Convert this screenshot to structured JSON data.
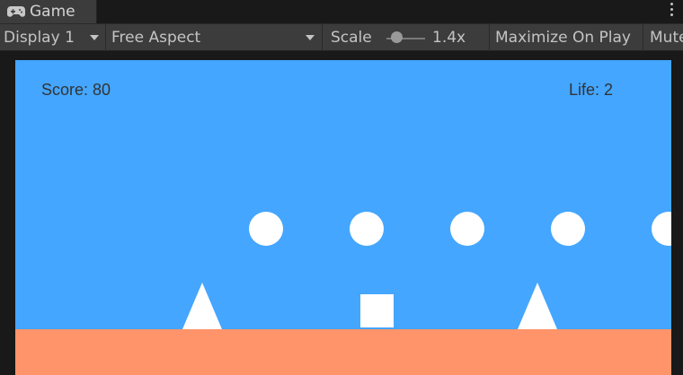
{
  "tab": {
    "label": "Game",
    "icon": "gamepad-icon"
  },
  "toolbar": {
    "display_label": "Display 1",
    "aspect_label": "Free Aspect",
    "scale_label": "Scale",
    "scale_value": "1.4x",
    "maximize_label": "Maximize On Play",
    "mute_label": "Mute"
  },
  "hud": {
    "score": "Score: 80",
    "life": "Life: 2"
  },
  "colors": {
    "sky": "#44a6ff",
    "ground": "#ff946b",
    "objects": "#ffffff",
    "editor_bg": "#3c3c3c"
  }
}
